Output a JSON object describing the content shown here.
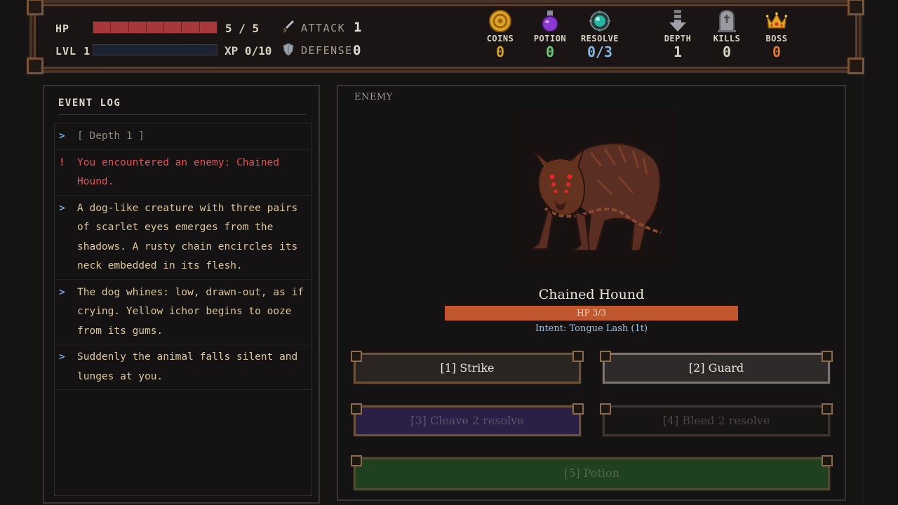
{
  "stats": {
    "hp_label": "HP",
    "hp_value": "5 / 5",
    "hp_fraction": 1.0,
    "lvl_label": "LVL 1",
    "xp_value": "XP 0/10",
    "xp_fraction": 0.0,
    "attack_label": "ATTACK",
    "attack_value": "1",
    "defense_label": "DEFENSE",
    "defense_value": "0"
  },
  "resources": {
    "coins": {
      "label": "COINS",
      "value": "0",
      "color": "#d7a12f"
    },
    "potion": {
      "label": "POTION",
      "value": "0",
      "color": "#6cc97b"
    },
    "resolve": {
      "label": "RESOLVE",
      "value": "0/3",
      "color": "#88b6e0"
    },
    "depth": {
      "label": "DEPTH",
      "value": "1",
      "color": "#d8d2c6"
    },
    "kills": {
      "label": "KILLS",
      "value": "0",
      "color": "#d8d2c6"
    },
    "boss": {
      "label": "BOSS",
      "value": "0",
      "color": "#e07a3d"
    }
  },
  "log": {
    "title": "EVENT LOG",
    "entries": [
      {
        "mark": ">",
        "text": "[ Depth 1 ]"
      },
      {
        "mark": "!",
        "text": "You encountered an enemy: Chained Hound."
      },
      {
        "mark": ">",
        "text": "A dog-like creature with three pairs of scarlet eyes emerges from the shadows. A rusty chain encircles its neck embedded in its flesh."
      },
      {
        "mark": ">",
        "text": "The dog whines: low, drawn-out, as if crying. Yellow ichor begins to ooze from its gums."
      },
      {
        "mark": ">",
        "text": "Suddenly the animal falls silent and lunges at you."
      }
    ]
  },
  "enemy": {
    "section_label": "ENEMY",
    "name": "Chained Hound",
    "hp_text": "HP 3/3",
    "hp_fraction": 1.0,
    "intent": "Intent: Tongue Lash (1t)"
  },
  "actions": {
    "strike": "[1] Strike",
    "guard": "[2] Guard",
    "cleave": "[3] Cleave 2 resolve",
    "bleed": "[4] Bleed 2 resolve",
    "potion": "[5] Potion"
  }
}
